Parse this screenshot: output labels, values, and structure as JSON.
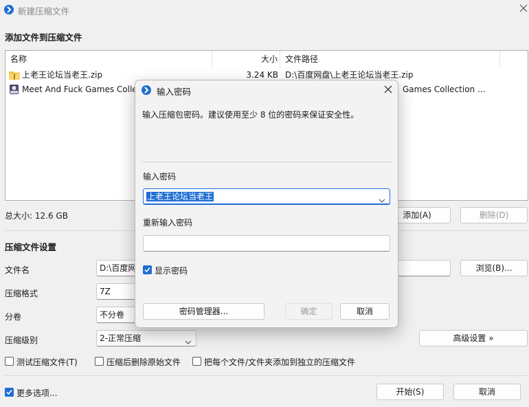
{
  "window": {
    "title": "新建压缩文件"
  },
  "add_section": {
    "title": "添加文件到压缩文件",
    "columns": {
      "name": "名称",
      "size": "大小",
      "path": "文件路径"
    },
    "files": [
      {
        "name": "上老王论坛当老王.zip",
        "size": "3.24 KB",
        "path": "D:\\百度网盘\\上老王论坛当老王.zip",
        "icon": "zip-folder-icon"
      },
      {
        "name": "Meet And Fuck Games Collec",
        "size": "",
        "path": "Games Collection ...",
        "icon": "game-app-icon"
      }
    ],
    "total_size": "总大小: 12.6 GB",
    "add_button": "添加(A)",
    "delete_button": "删除(D)"
  },
  "settings": {
    "title": "压缩文件设置",
    "filename_label": "文件名",
    "filename_value": "D:\\百度网",
    "browse_button": "浏览(B)...",
    "format_label": "压缩格式",
    "format_value": "7Z",
    "split_label": "分卷",
    "split_value": "不分卷",
    "level_label": "压缩级别",
    "level_value": "2-正常压缩",
    "advanced_button": "高级设置 »",
    "test_checkbox": "测试压缩文件(T)",
    "delete_after_checkbox": "压缩后删除原始文件",
    "separate_checkbox": "把每个文件/文件夹添加到独立的压缩文件"
  },
  "footer": {
    "more_options": "更多选项...",
    "start_button": "开始(S)",
    "cancel_button": "取消"
  },
  "password_dialog": {
    "title": "输入密码",
    "description": "输入压缩包密码。建议使用至少 8 位的密码来保证安全性。",
    "enter_label": "输入密码",
    "password_value": "上老王论坛当老王",
    "reenter_label": "重新输入密码",
    "reenter_value": "",
    "show_password": "显示密码",
    "manager_button": "密码管理器...",
    "ok_button": "确定",
    "cancel_button": "取消"
  },
  "colors": {
    "accent": "#1f6ed4",
    "disabled_text": "#9b9b9b"
  }
}
